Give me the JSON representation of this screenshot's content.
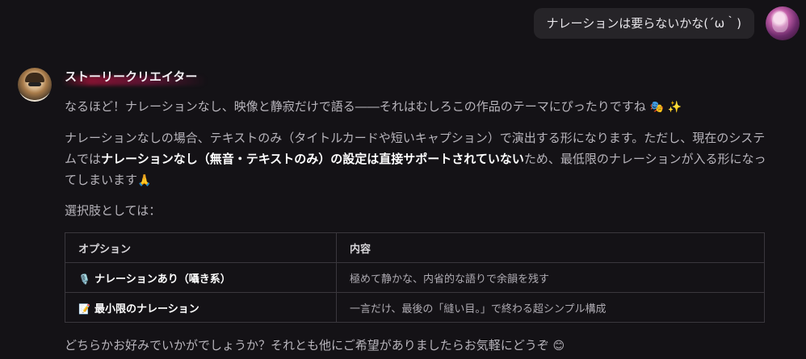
{
  "user_message": {
    "text": "ナレーションは要らないかな(´ω｀)"
  },
  "bot": {
    "name": "ストーリークリエイター",
    "p1": "なるほど！ナレーションなし、映像と静寂だけで語る――それはむしろこの作品のテーマにぴったりですね",
    "p1_emoji1": "🎭",
    "p1_emoji2": "✨",
    "p2_a": "ナレーションなしの場合、テキストのみ（タイトルカードや短いキャプション）で演出する形になります。ただし、現在のシステムでは",
    "p2_bold": "ナレーションなし（無音・テキストのみ）の設定は直接サポートされていない",
    "p2_b": "ため、最低限のナレーションが入る形になってしまいます",
    "p2_emoji": "🙏",
    "p3": "選択肢としては：",
    "table": {
      "headers": [
        "オプション",
        "内容"
      ],
      "rows": [
        {
          "icon": "🎙️",
          "option": "ナレーションあり（囁き系）",
          "content": "極めて静かな、内省的な語りで余韻を残す"
        },
        {
          "icon": "📝",
          "option": "最小限のナレーション",
          "content": "一言だけ、最後の「縫い目。」で終わる超シンプル構成"
        }
      ]
    },
    "p4": "どちらかお好みでいかがでしょうか？それとも他にご希望がありましたらお気軽にどうぞ",
    "p4_emoji": "😊"
  }
}
